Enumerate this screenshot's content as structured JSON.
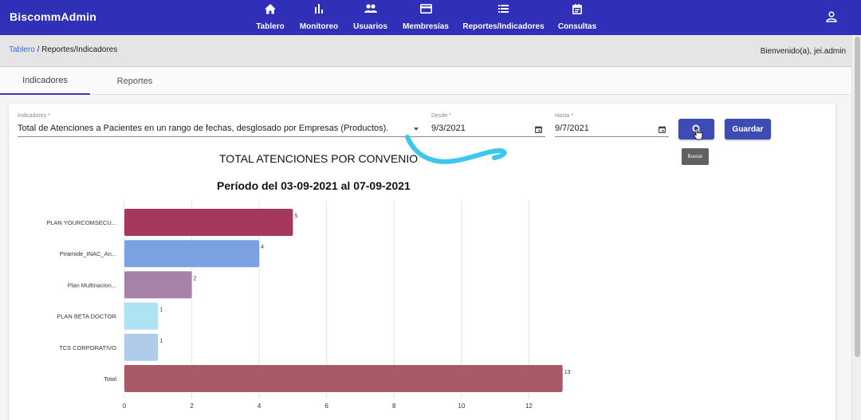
{
  "app": {
    "title": "BiscommAdmin"
  },
  "nav": {
    "items": [
      {
        "label": "Tablero",
        "icon": "home-icon"
      },
      {
        "label": "Monitoreo",
        "icon": "bar-chart-icon"
      },
      {
        "label": "Usuarios",
        "icon": "people-icon"
      },
      {
        "label": "Membresías",
        "icon": "card-icon"
      },
      {
        "label": "Reportes/Indicadores",
        "icon": "list-icon"
      },
      {
        "label": "Consultas",
        "icon": "calendar-icon"
      }
    ],
    "user_icon": "account-icon"
  },
  "breadcrumb": {
    "root": "Tablero",
    "separator": " / ",
    "current": "Reportes/Indicadores"
  },
  "welcome": "Bienvenido(a), jei.admin",
  "tabs": [
    {
      "label": "Indicadores",
      "active": true
    },
    {
      "label": "Reportes",
      "active": false
    }
  ],
  "form": {
    "indicator": {
      "label": "Indicadores *",
      "value": "Total de Atenciones a Pacientes en un rango de fechas, desglosado por Empresas (Productos)."
    },
    "from": {
      "label": "Desde *",
      "value": "9/3/2021"
    },
    "to": {
      "label": "Hasta *",
      "value": "9/7/2021"
    },
    "search_icon": "search-icon",
    "search_tooltip": "Buscar",
    "save_label": "Guardar"
  },
  "colors": {
    "navbar": "#2f2fb8",
    "button": "#3f4bb5",
    "annotation": "#3cc7ee"
  },
  "chart_data": {
    "type": "bar",
    "orientation": "horizontal",
    "title": "TOTAL ATENCIONES POR CONVENIO",
    "subtitle": "Período del 03-09-2021 al 07-09-2021",
    "categories": [
      "PLAN YOURCOMSECU...",
      "Piramide_INAC_An...",
      "Plan Multinacion...",
      "PLAN BETA DOCTOR",
      "TCS CORPORATIVO",
      "Total"
    ],
    "values": [
      5,
      4,
      2,
      1,
      1,
      13
    ],
    "colors": [
      "#a6385c",
      "#7aa2e3",
      "#a681a8",
      "#ade3f5",
      "#aecbe9",
      "#a85a67"
    ],
    "xlim": [
      0,
      14
    ],
    "xticks": [
      0,
      2,
      4,
      6,
      8,
      10,
      12
    ],
    "grid": true,
    "legend": "none"
  }
}
